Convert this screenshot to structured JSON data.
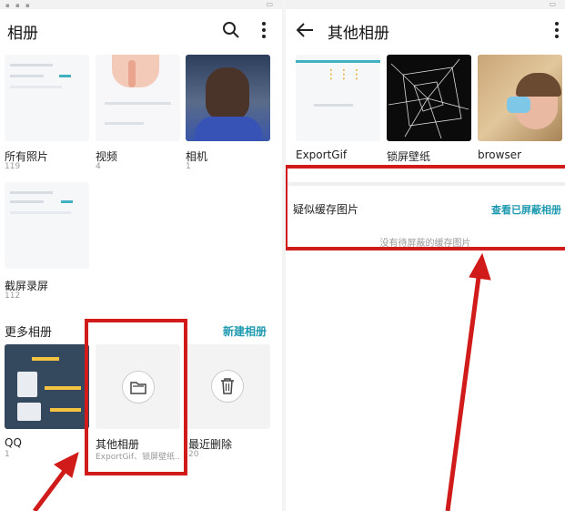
{
  "left": {
    "title": "相册",
    "albums": [
      {
        "name": "所有照片",
        "count": "119"
      },
      {
        "name": "视频",
        "count": "4"
      },
      {
        "name": "相机",
        "count": "1"
      },
      {
        "name": "截屏录屏",
        "count": "112"
      }
    ],
    "more_section": "更多相册",
    "new_album": "新建相册",
    "more_albums": [
      {
        "name": "QQ",
        "count": "1"
      },
      {
        "name": "其他相册",
        "count": "ExportGif、锁屏壁纸..."
      },
      {
        "name": "最近删除",
        "count": "20"
      }
    ]
  },
  "right": {
    "title": "其他相册",
    "albums": [
      {
        "name": "ExportGif"
      },
      {
        "name": "锁屏壁纸"
      },
      {
        "name": "browser"
      }
    ],
    "cache_title": "疑似缓存图片",
    "cache_link": "查看已屏蔽相册",
    "cache_empty": "没有待屏蔽的缓存图片"
  },
  "colors": {
    "accent": "#1f9ab0",
    "annotation": "#d11a1a"
  },
  "icons": [
    "search-icon",
    "more-vertical-icon",
    "back-arrow-icon",
    "folder-icon",
    "trash-icon"
  ]
}
